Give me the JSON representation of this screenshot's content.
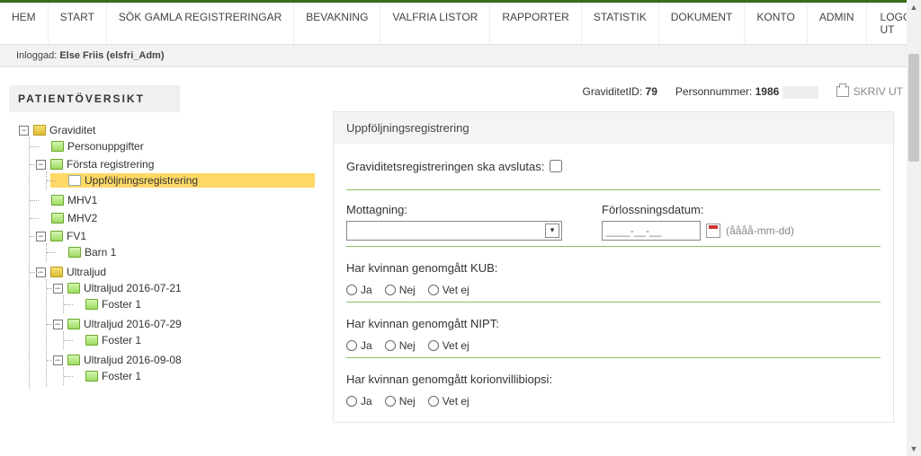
{
  "nav": {
    "items": [
      "HEM",
      "START",
      "SÖK GAMLA REGISTRERINGAR",
      "BEVAKNING",
      "VALFRIA LISTOR",
      "RAPPORTER",
      "STATISTIK",
      "DOKUMENT",
      "KONTO",
      "ADMIN"
    ],
    "logout": "LOGGA UT"
  },
  "login_bar": {
    "label": "Inloggad:",
    "user": "Else Friis (elsfri_Adm)"
  },
  "overview_title": "PATIENTÖVERSIKT",
  "meta": {
    "grav_label": "GraviditetID:",
    "grav_value": "79",
    "pn_label": "Personnummer:",
    "pn_value": "1986",
    "print": "SKRIV UT"
  },
  "tree": {
    "root": "Graviditet",
    "personuppgifter": "Personuppgifter",
    "forsta": "Första registrering",
    "uppf": "Uppföljningsregistrering",
    "mhv1": "MHV1",
    "mhv2": "MHV2",
    "fv1": "FV1",
    "barn1": "Barn 1",
    "ultraljud": "Ultraljud",
    "ul1": "Ultraljud 2016-07-21",
    "ul2": "Ultraljud 2016-07-29",
    "ul3": "Ultraljud 2016-09-08",
    "foster1": "Foster 1"
  },
  "form": {
    "title": "Uppföljningsregistrering",
    "close_label": "Graviditetsregistreringen ska avslutas:",
    "mottagning_label": "Mottagning:",
    "forloss_label": "Förlossningsdatum:",
    "date_placeholder": "____-__-__",
    "date_hint": "(åååå-mm-dd)",
    "q_kub": "Har kvinnan genomgått KUB:",
    "q_nipt": "Har kvinnan genomgått NIPT:",
    "q_korion": "Har kvinnan genomgått korionvillibiopsi:",
    "opt_ja": "Ja",
    "opt_nej": "Nej",
    "opt_vetej": "Vet ej"
  }
}
